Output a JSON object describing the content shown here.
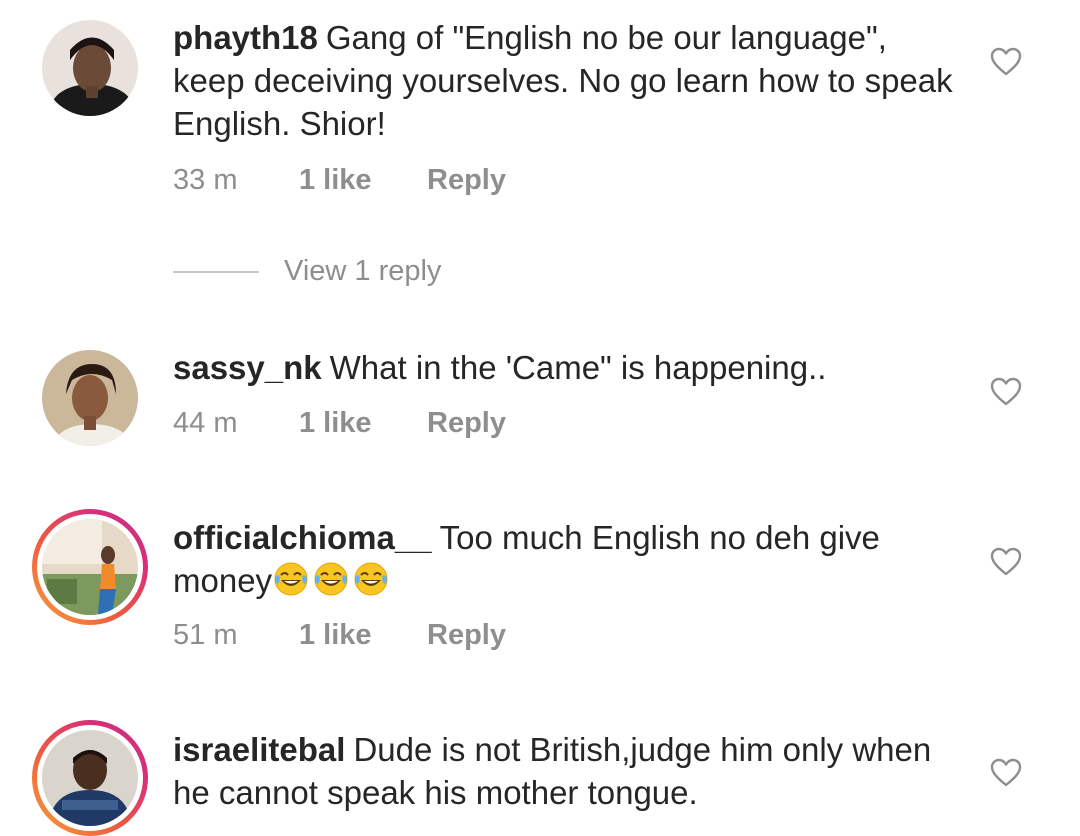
{
  "comments": [
    {
      "username": "phayth18",
      "text": "Gang of \"English no be our language\", keep deceiving yourselves. No go learn how to speak English. Shior!",
      "time": "33 m",
      "likes": "1 like",
      "reply_label": "Reply",
      "view_replies": "View 1 reply",
      "avatar_ring": false
    },
    {
      "username": "sassy_nk",
      "text": "What in the 'Came\" is happening..",
      "time": "44 m",
      "likes": "1 like",
      "reply_label": "Reply",
      "avatar_ring": false
    },
    {
      "username": "officialchioma__",
      "text": "Too much English no deh give money",
      "emojis": [
        "face-with-tears-of-joy",
        "face-with-tears-of-joy",
        "face-with-tears-of-joy"
      ],
      "time": "51 m",
      "likes": "1 like",
      "reply_label": "Reply",
      "avatar_ring": true
    },
    {
      "username": "israelitebal",
      "text": "Dude is not British,judge him only when he  cannot speak his mother tongue.",
      "avatar_ring": true
    }
  ],
  "icons": {
    "like": "heart-outline-icon",
    "emoji": "face-with-tears-of-joy"
  },
  "colors": {
    "text": "#262626",
    "secondary": "#8e8e8e",
    "story_ring_start": "#f7a43a",
    "story_ring_end": "#c13584"
  }
}
